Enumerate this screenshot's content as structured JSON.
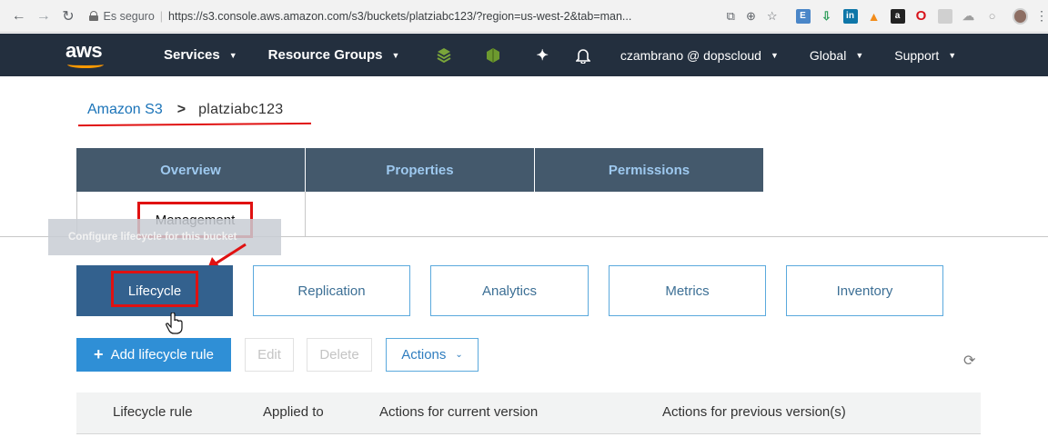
{
  "browser": {
    "secure_label": "Es seguro",
    "url": "https://s3.console.aws.amazon.com/s3/buckets/platziabc123/?region=us-west-2&tab=man..."
  },
  "aws_nav": {
    "logo": "aws",
    "services": "Services",
    "resource_groups": "Resource Groups",
    "user": "czambrano @ dopscloud",
    "region": "Global",
    "support": "Support"
  },
  "breadcrumb": {
    "root": "Amazon S3",
    "separator": ">",
    "current": "platziabc123"
  },
  "tabs": {
    "overview": "Overview",
    "properties": "Properties",
    "permissions": "Permissions",
    "management": "Management"
  },
  "tooltip": "Configure lifecycle for this bucket",
  "subtabs": {
    "lifecycle": "Lifecycle",
    "replication": "Replication",
    "analytics": "Analytics",
    "metrics": "Metrics",
    "inventory": "Inventory"
  },
  "actions": {
    "add": "Add lifecycle rule",
    "edit": "Edit",
    "delete": "Delete",
    "actions": "Actions"
  },
  "table": {
    "columns": [
      "Lifecycle rule",
      "Applied to",
      "Actions for current version",
      "Actions for previous version(s)"
    ]
  },
  "colors": {
    "aws_nav_bg": "#232f3e",
    "aws_orange": "#ff9900",
    "tab_bg": "#44596c",
    "tab_text": "#9ec9ef",
    "subtab_active": "#33618e",
    "primary_button": "#2f8fd6",
    "annotation_red": "#e01111"
  }
}
